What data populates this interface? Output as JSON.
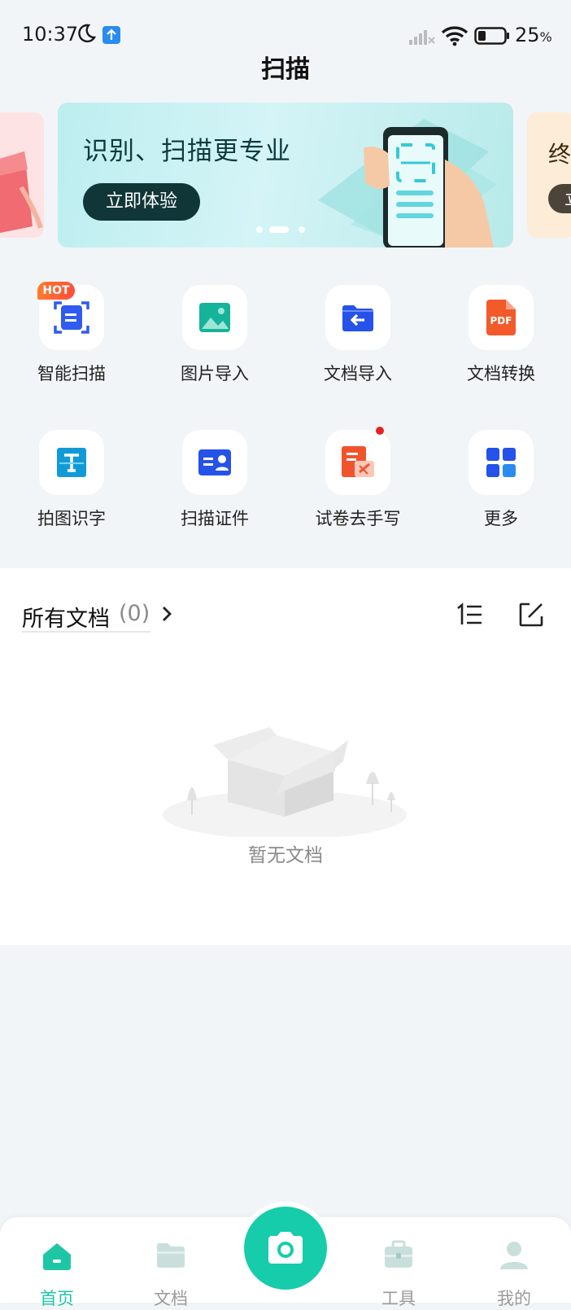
{
  "status_bar": {
    "time": "10:37",
    "battery": "25",
    "battery_unit": "%"
  },
  "page": {
    "title": "扫描"
  },
  "banner": {
    "title": "识别、扫描更专业",
    "button": "立即体验",
    "next_card_title": "终",
    "next_card_button": "立"
  },
  "features": [
    {
      "label": "智能扫描",
      "icon": "smart-scan-icon",
      "badge": "HOT"
    },
    {
      "label": "图片导入",
      "icon": "image-import-icon"
    },
    {
      "label": "文档导入",
      "icon": "document-import-icon"
    },
    {
      "label": "文档转换",
      "icon": "pdf-convert-icon",
      "icon_text": "PDF"
    },
    {
      "label": "拍图识字",
      "icon": "text-recognition-icon"
    },
    {
      "label": "扫描证件",
      "icon": "id-card-scan-icon"
    },
    {
      "label": "试卷去手写",
      "icon": "remove-handwriting-icon"
    },
    {
      "label": "更多",
      "icon": "more-grid-icon"
    }
  ],
  "documents": {
    "title": "所有文档",
    "count": "(0)",
    "empty_text": "暂无文档"
  },
  "bottom_nav": {
    "items": [
      {
        "label": "首页",
        "icon": "home-icon",
        "active": true
      },
      {
        "label": "文档",
        "icon": "folder-icon",
        "active": false
      },
      {
        "label": "工具",
        "icon": "toolbox-icon",
        "active": false
      },
      {
        "label": "我的",
        "icon": "profile-icon",
        "active": false
      }
    ]
  },
  "colors": {
    "accent": "#17ccaa",
    "background": "#f2f5f7",
    "banner_button": "#113638",
    "hot_badge": "#ff5a34"
  }
}
